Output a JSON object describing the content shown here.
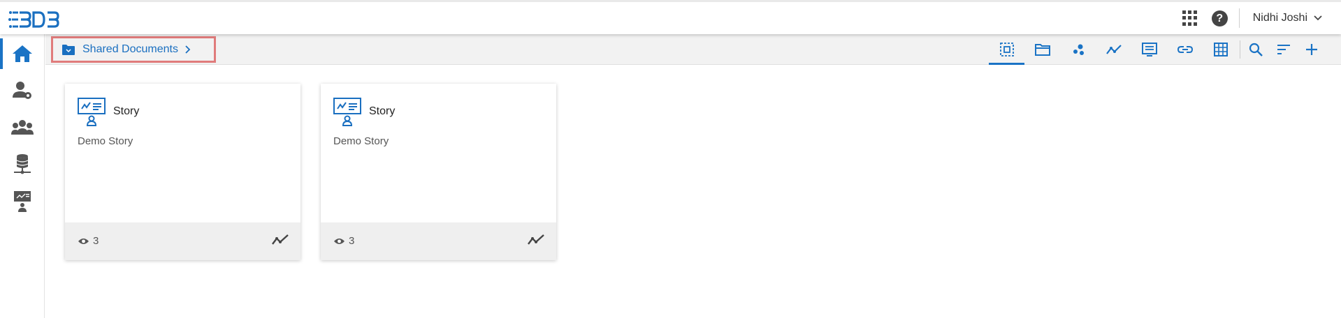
{
  "header": {
    "logo_label": "BDB",
    "user_name": "Nidhi Joshi",
    "icons": [
      "apps-grid-icon",
      "help-icon",
      "chevron-down-icon"
    ]
  },
  "sidebar": {
    "items": [
      {
        "name": "home",
        "icon": "home-icon",
        "active": true
      },
      {
        "name": "user-settings",
        "icon": "user-gear-icon",
        "active": false
      },
      {
        "name": "groups",
        "icon": "users-group-icon",
        "active": false
      },
      {
        "name": "data-connectors",
        "icon": "database-network-icon",
        "active": false
      },
      {
        "name": "presenter",
        "icon": "presentation-user-icon",
        "active": false
      }
    ]
  },
  "breadcrumb": {
    "label": "Shared Documents"
  },
  "toolbar": {
    "tools": [
      "select-all-icon",
      "folder-icon",
      "scatter-chart-icon",
      "line-chart-icon",
      "list-view-icon",
      "link-icon",
      "grid-view-icon",
      "search-icon",
      "sort-icon",
      "add-icon"
    ]
  },
  "cards": [
    {
      "type": "Story",
      "description": "Demo Story",
      "views": "3"
    },
    {
      "type": "Story",
      "description": "Demo Story",
      "views": "3"
    }
  ],
  "colors": {
    "accent": "#1a73c5",
    "highlight_border": "#e07b7b",
    "subbar_bg": "#f2f2f2",
    "card_footer_bg": "#efefef"
  }
}
